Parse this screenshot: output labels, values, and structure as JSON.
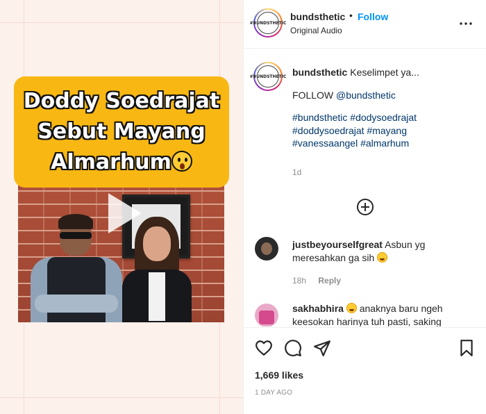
{
  "media": {
    "caption_line1": "Doddy Soedrajat",
    "caption_line2": "Sebut Mayang",
    "caption_line3": "Almarhum",
    "caption_emoji": "astonished-face-emoji",
    "colors": {
      "caption_bg": "#f8b712",
      "pane_bg": "#fdf1ec"
    }
  },
  "header": {
    "username": "bundsthetic",
    "separator": "•",
    "follow_label": "Follow",
    "subtitle": "Original Audio",
    "avatar_text": "#BUNDSTHETIC",
    "more_icon": "more-horizontal-icon"
  },
  "caption": {
    "username": "bundsthetic",
    "text": "Keselimpet ya...",
    "follow_prefix": "FOLLOW ",
    "follow_mention": "@bundsthetic",
    "hashtags_line1": "#bundsthetic #dodysoedrajat",
    "hashtags_line2": "#doddysoedrajat #mayang",
    "hashtags_line3": "#vanessaangel #almarhum",
    "timestamp": "1d"
  },
  "comments": [
    {
      "username": "justbeyourselfgreat",
      "text": "Asbun yg meresahkan ga sih",
      "time": "18h",
      "reply_label": "Reply"
    },
    {
      "username": "sakhabhira",
      "text": "anaknya baru ngeh keesokan harinya tuh pasti, saking"
    }
  ],
  "actions": {
    "likes": "1,669 likes",
    "date": "1 DAY AGO"
  },
  "colors": {
    "link": "#00376b",
    "follow": "#0095f6",
    "muted": "#8e8e8e"
  }
}
